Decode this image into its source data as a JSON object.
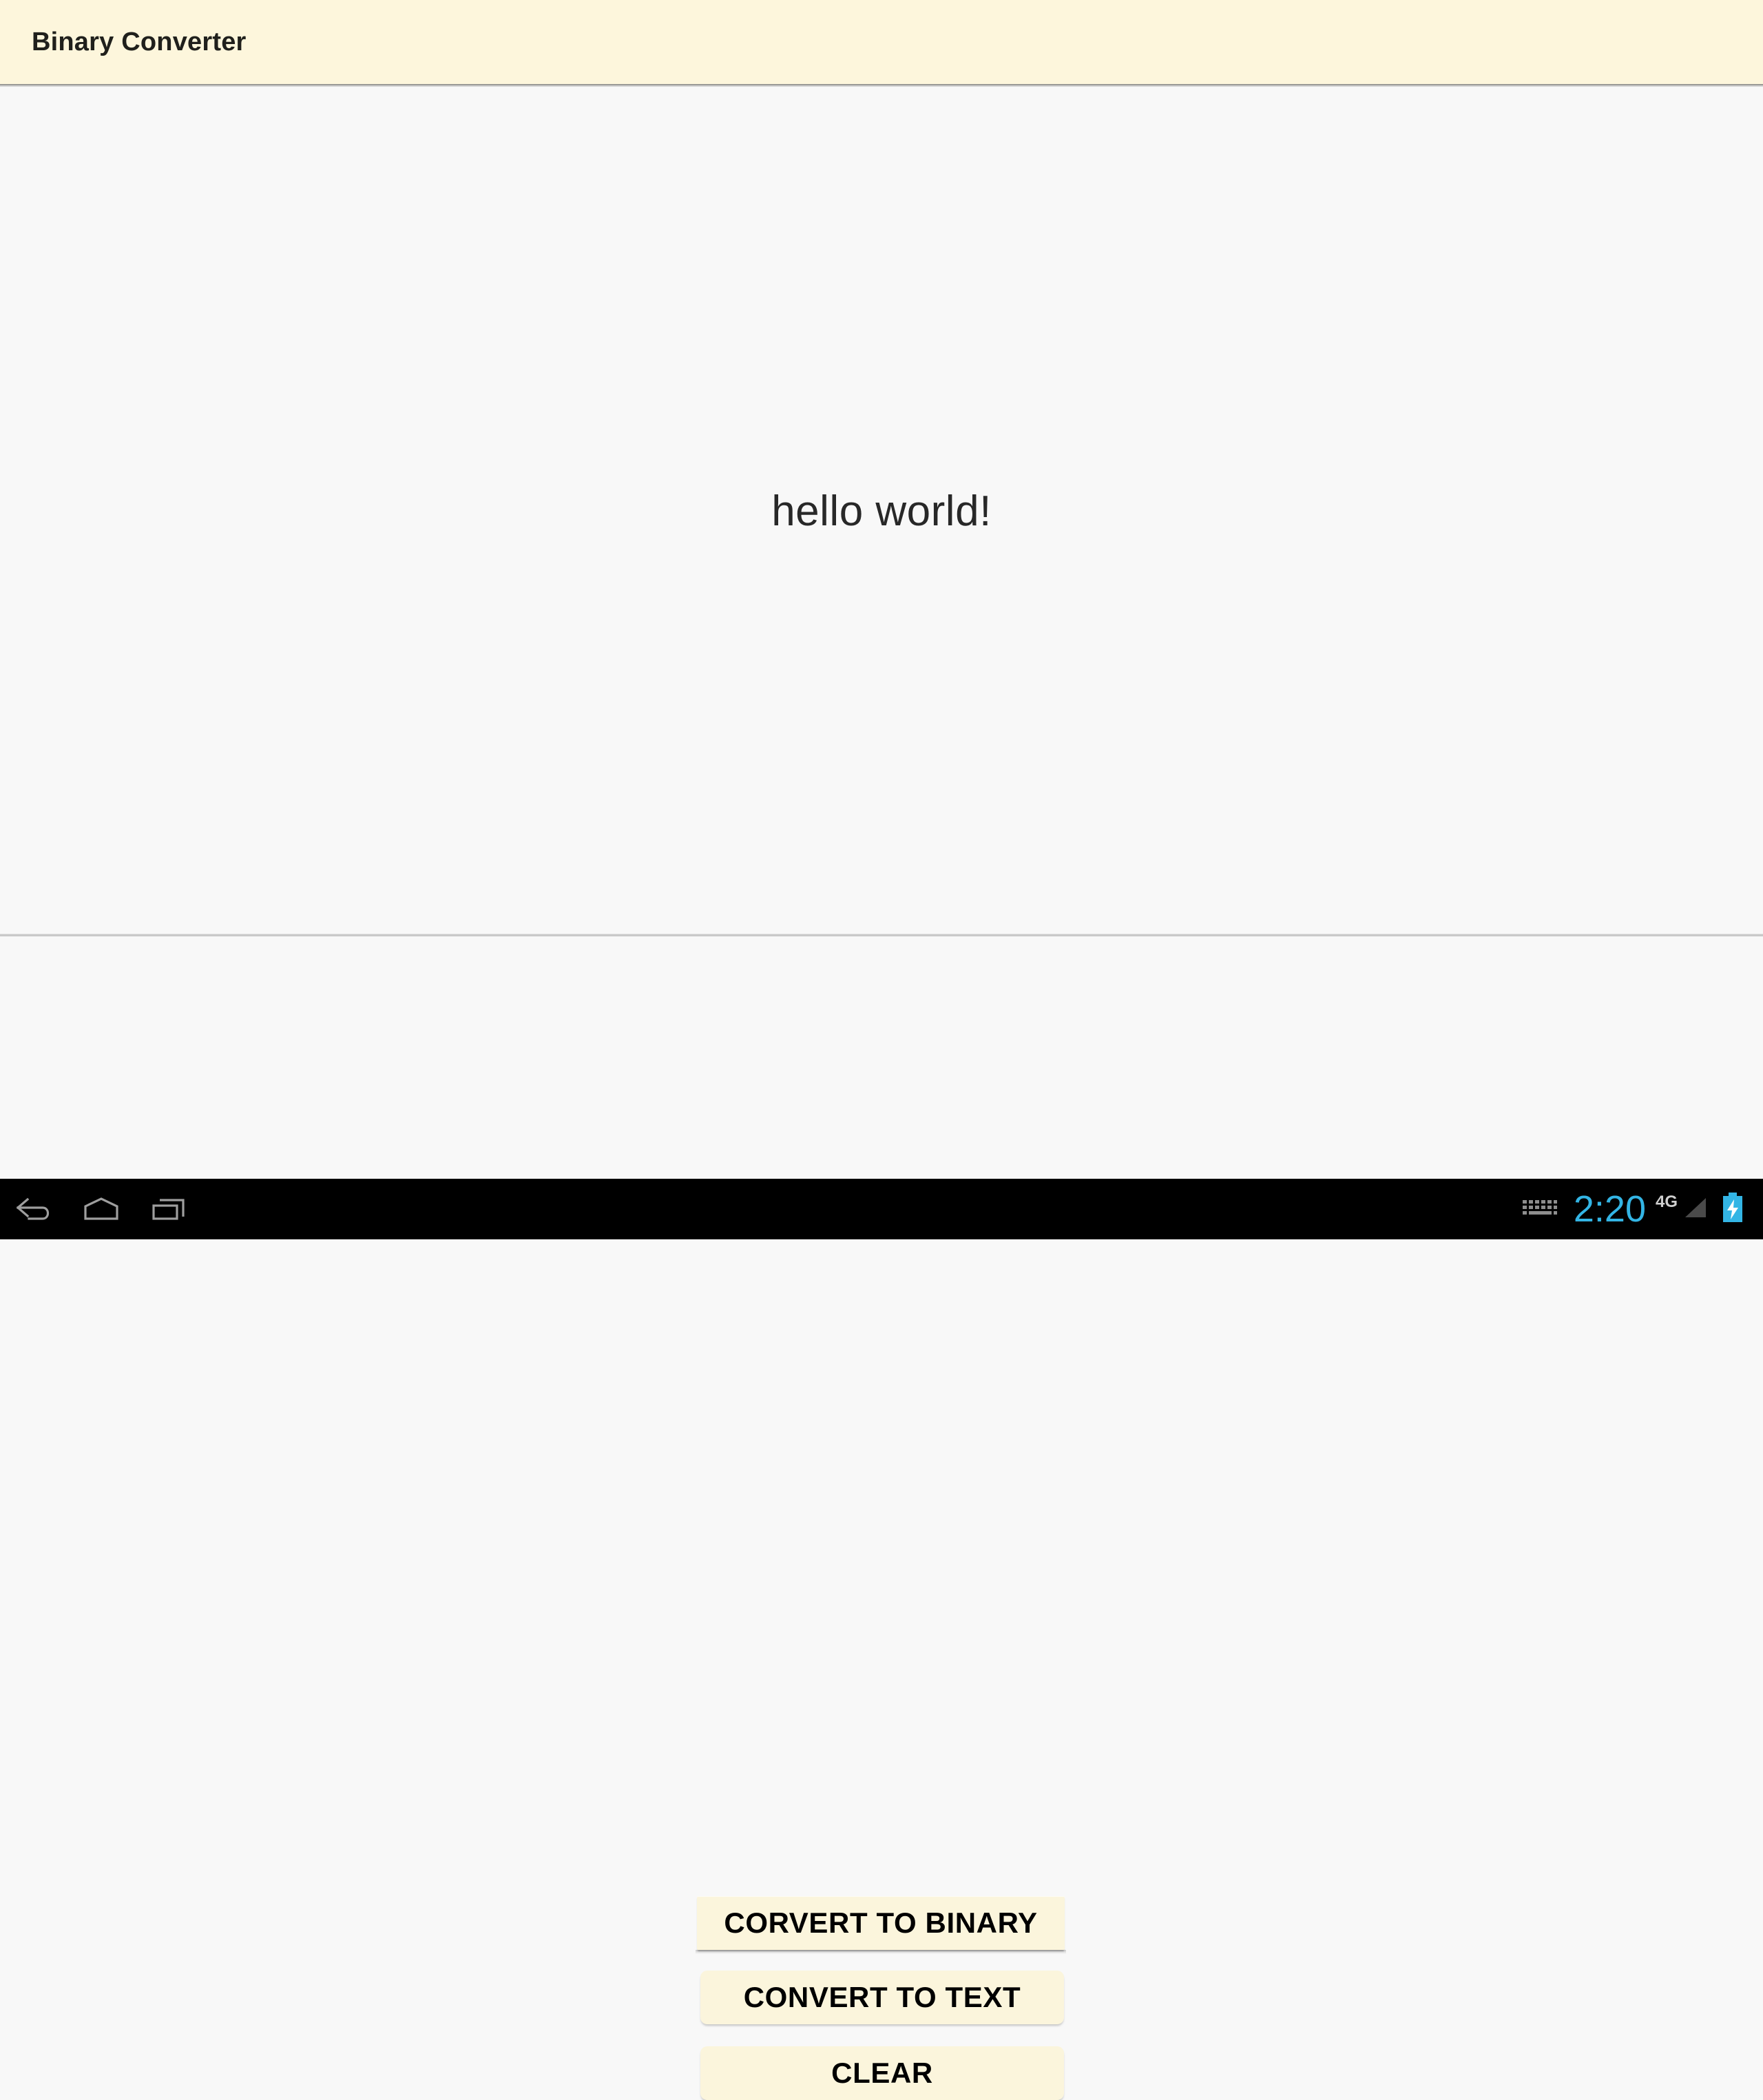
{
  "window": {
    "app_title": "Binary Converter"
  },
  "content": {
    "display_text": "hello world!"
  },
  "actions": {
    "convert_to_binary_label": "CORVERT TO BINARY",
    "convert_to_text_label": "CONVERT TO TEXT",
    "clear_label": "CLEAR"
  },
  "navbar": {
    "back_label": "Back",
    "home_label": "Home",
    "recents_label": "Recent apps",
    "icons": [
      "back-icon",
      "home-icon",
      "recents-icon"
    ]
  },
  "status_bar": {
    "keyboard_icon": "keyboard-icon",
    "time": "2:20",
    "network_type": "4G",
    "signal_icon": "signal-triangle-icon",
    "battery_icon": "battery-charging-icon"
  },
  "colors": {
    "titlebar_bg": "#fdf6dc",
    "button_bg": "#fbf5dc",
    "content_bg": "#f8f8f8",
    "accent_blue": "#33b5e5",
    "navbar_bg": "#000000",
    "text_primary": "#282828"
  }
}
